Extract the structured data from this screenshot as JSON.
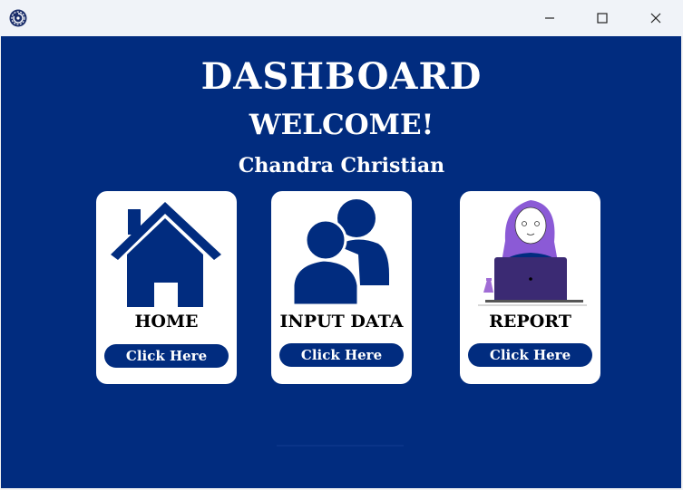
{
  "window": {
    "app_icon": "gear-spiral-icon",
    "minimize_icon": "minimize-icon",
    "maximize_icon": "maximize-icon",
    "close_icon": "close-icon"
  },
  "colors": {
    "background": "#012c7f",
    "card": "#ffffff",
    "button": "#012c7f",
    "button_text": "#ffffff"
  },
  "header": {
    "title": "DASHBOARD",
    "welcome": "WELCOME!",
    "user_name": "Chandra Christian"
  },
  "cards": [
    {
      "icon": "house-icon",
      "label": "HOME",
      "button": "Click Here"
    },
    {
      "icon": "users-icon",
      "label": "INPUT DATA",
      "button": "Click Here"
    },
    {
      "icon": "woman-laptop-illustration",
      "label": "REPORT",
      "button": "Click Here"
    }
  ]
}
